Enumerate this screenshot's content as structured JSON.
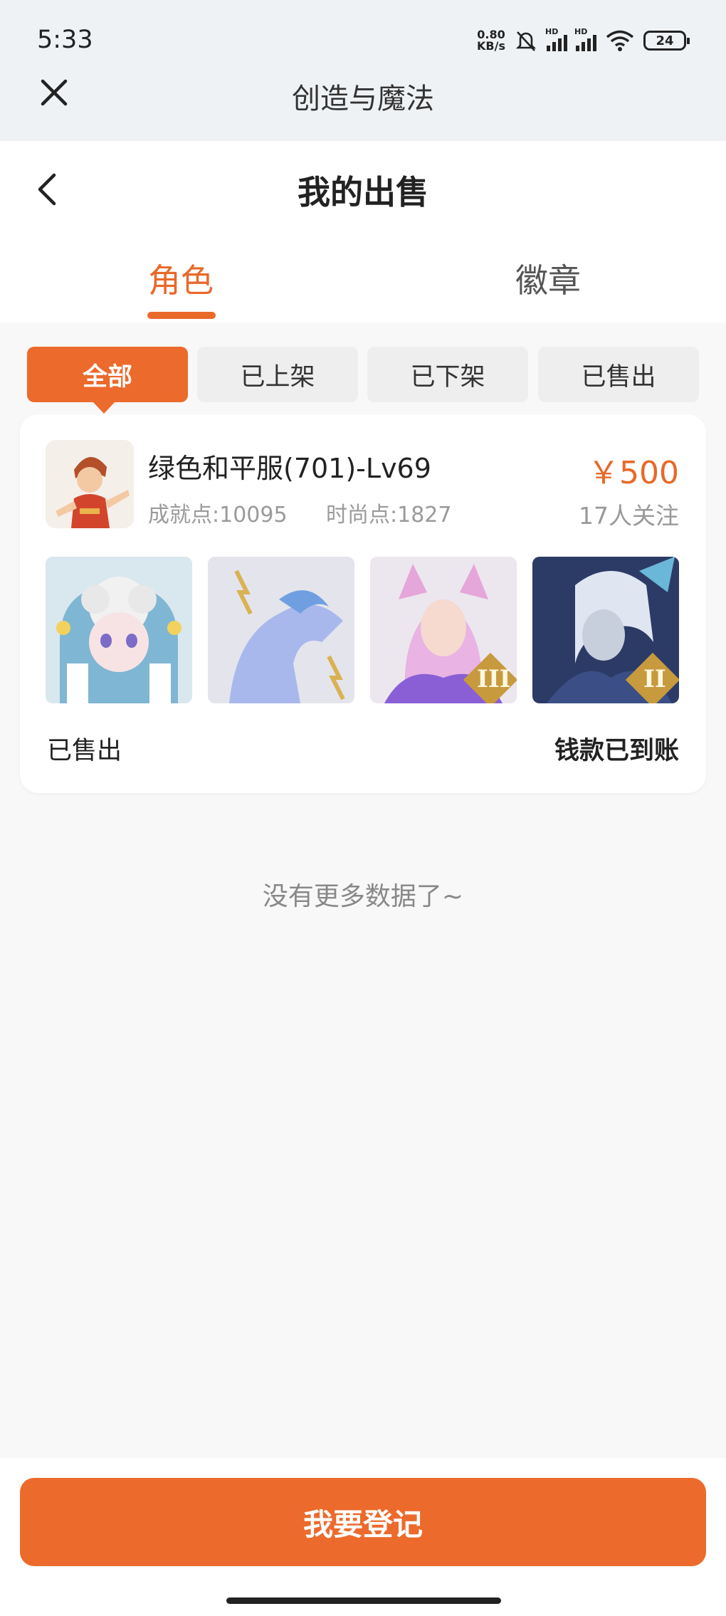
{
  "status_bar": {
    "time": "5:33",
    "net_speed_value": "0.80",
    "net_speed_unit": "KB/s",
    "sim1_label": "HD",
    "sim2_label": "HD",
    "battery": "24"
  },
  "app_bar": {
    "title": "创造与魔法",
    "close_icon": "close-icon"
  },
  "header": {
    "title": "我的出售",
    "back_icon": "chevron-left-icon"
  },
  "tabs": [
    {
      "label": "角色",
      "active": true
    },
    {
      "label": "徽章",
      "active": false
    }
  ],
  "filters": [
    {
      "label": "全部",
      "active": true
    },
    {
      "label": "已上架",
      "active": false
    },
    {
      "label": "已下架",
      "active": false
    },
    {
      "label": "已售出",
      "active": false
    }
  ],
  "listing": {
    "name": "绿色和平服(701)-Lv69",
    "achievement": "成就点:10095",
    "fashion": "时尚点:1827",
    "price": "￥500",
    "followers": "17人关注",
    "sale_status": "已售出",
    "payment_status": "钱款已到账",
    "thumb_badges": [
      "",
      "",
      "III",
      "II"
    ]
  },
  "empty_hint": "没有更多数据了~",
  "primary_action": "我要登记",
  "colors": {
    "accent": "#ec6a2c",
    "top_bg": "#eff2f5",
    "page_bg": "#f8f8f8"
  }
}
